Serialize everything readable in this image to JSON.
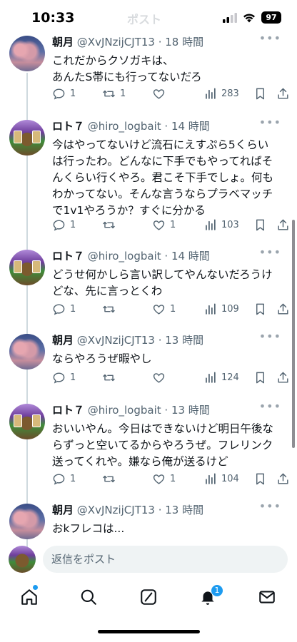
{
  "status_bar": {
    "time": "10:33",
    "battery": "97"
  },
  "header": {
    "title": "ポスト"
  },
  "tweets": [
    {
      "name": "朝月",
      "handle": "@XvJNzijCJT13",
      "time": "18 時間",
      "text": "これだからクソガキは、\nあんたS帯にも行ってないだろ",
      "replies": "1",
      "reposts": "1",
      "likes": "",
      "views": "283"
    },
    {
      "name": "ロト７",
      "handle": "@hiro_logbait",
      "time": "14 時間",
      "text": "今はやってないけど流石にえすぷら5くらい\nは行ったわ。どんなに下手でもやってればそ\nんくらい行くやろ。君こそ下手でしょ。何も\nわかってない。そんな言うならプラベマッチ\nで1v1やろうか？すぐに分かる",
      "replies": "1",
      "reposts": "",
      "likes": "1",
      "views": "103"
    },
    {
      "name": "ロト７",
      "handle": "@hiro_logbait",
      "time": "14 時間",
      "text": "どうせ何かしら言い訳してやんないだろうけ\nどな、先に言っとくわ",
      "replies": "1",
      "reposts": "",
      "likes": "1",
      "views": "109"
    },
    {
      "name": "朝月",
      "handle": "@XvJNzijCJT13",
      "time": "13 時間",
      "text": "ならやろうぜ暇やし",
      "replies": "1",
      "reposts": "",
      "likes": "",
      "views": "124"
    },
    {
      "name": "ロト７",
      "handle": "@hiro_logbait",
      "time": "13 時間",
      "text": "おいいやん。今日はできないけど明日午後な\nらずっと空いてるからやろうぜ。フレリンク\n送ってくれや。嫌なら俺が送るけど",
      "replies": "1",
      "reposts": "",
      "likes": "1",
      "views": "104"
    },
    {
      "name": "朝月",
      "handle": "@XvJNzijCJT13",
      "time": "13 時間",
      "text": "おkフレコは...",
      "replies": "",
      "reposts": "",
      "likes": "",
      "views": ""
    }
  ],
  "reply_bar": {
    "placeholder": "返信をポスト"
  },
  "nav": {
    "notification_count": "1"
  },
  "colors": {
    "accent": "#1d9bf0",
    "text": "#0f1419",
    "muted": "#536471"
  }
}
